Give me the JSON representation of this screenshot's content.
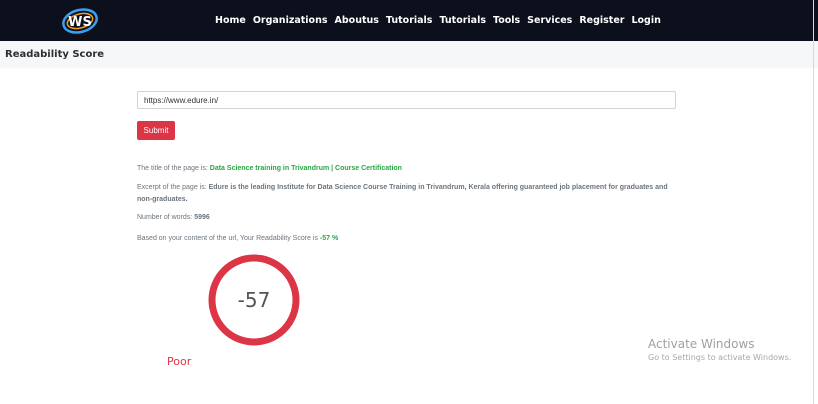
{
  "nav": {
    "logo_icon": "ws-logo-icon",
    "links": [
      "Home",
      "Organizations",
      "Aboutus",
      "Tutorials",
      "Tutorials",
      "Tools",
      "Services",
      "Register",
      "Login"
    ]
  },
  "page": {
    "title": "Readability Score"
  },
  "form": {
    "url_value": "https://www.edure.in/",
    "submit_label": "Submit"
  },
  "results": {
    "title_label": "The title of the page is:",
    "title_value": "Data Science training in Trivandrum | Course Certification",
    "excerpt_label": "Excerpt of the page is:",
    "excerpt_value": "Edure is the leading Institute for Data Science Course Training in Trivandrum, Kerala offering guaranteed job placement for graduates and non-graduates.",
    "words_label": "Number of words:",
    "words_value": "5996",
    "score_label": "Based on your content of the url, Your Readability Score is",
    "score_value": "-57 %"
  },
  "gauge": {
    "value": "-57",
    "rating": "Poor",
    "ring_color": "#dc3545"
  },
  "watermark": {
    "title": "Activate Windows",
    "subtitle": "Go to Settings to activate Windows."
  },
  "colors": {
    "navbar_bg": "#0c0f1c",
    "accent": "#dc3545",
    "green": "#28a745"
  }
}
